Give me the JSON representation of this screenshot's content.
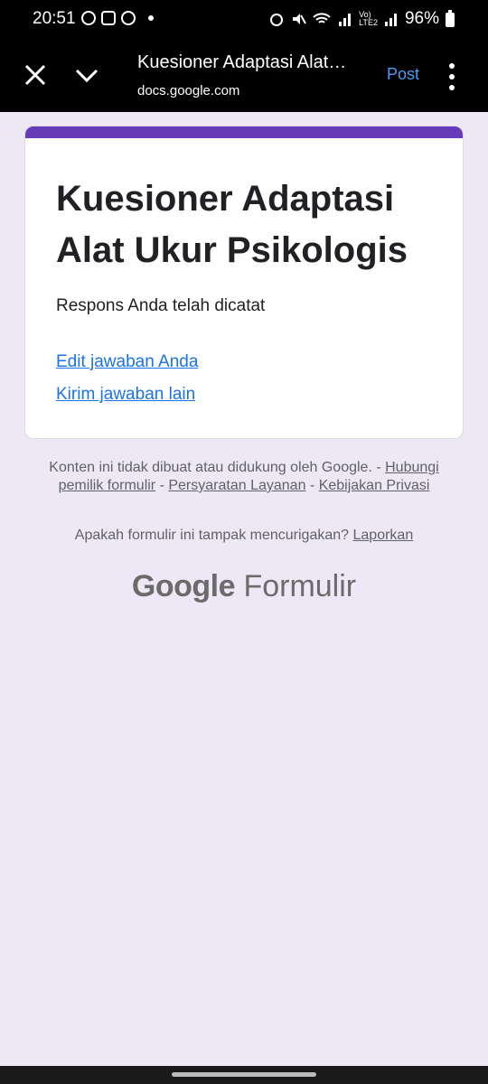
{
  "status_bar": {
    "time": "20:51",
    "battery": "96%",
    "left_icons": [
      "whatsapp-icon",
      "instagram-icon",
      "dnd-icon",
      "dot-icon"
    ],
    "right_icons": [
      "alarm-icon",
      "mute-icon",
      "wifi-icon",
      "signal-icon",
      "volte-icon",
      "battery-icon"
    ]
  },
  "app_bar": {
    "title": "Kuesioner Adaptasi Alat…",
    "url": "docs.google.com",
    "post_label": "Post",
    "post_color": "#4a9bf5"
  },
  "form": {
    "title": "Kuesioner Adaptasi Alat Ukur Psikologis",
    "response_message": "Respons Anda telah dicatat",
    "edit_link": "Edit jawaban Anda",
    "submit_another_link": "Kirim jawaban lain",
    "accent_color": "#673ab7",
    "link_color": "#1a73e8"
  },
  "footer": {
    "disclaimer": "Konten ini tidak dibuat atau didukung oleh Google.",
    "sep1": " - ",
    "contact_owner": "Hubungi pemilik formulir",
    "sep2": " - ",
    "terms": "Persyaratan Layanan",
    "sep3": " - ",
    "privacy": "Kebijakan Privasi",
    "report_question": "Apakah formulir ini tampak mencurigakan?",
    "report_link": "Laporkan",
    "brand_google": "Google",
    "brand_product": "Formulir"
  },
  "background_color": "#ede7f6"
}
